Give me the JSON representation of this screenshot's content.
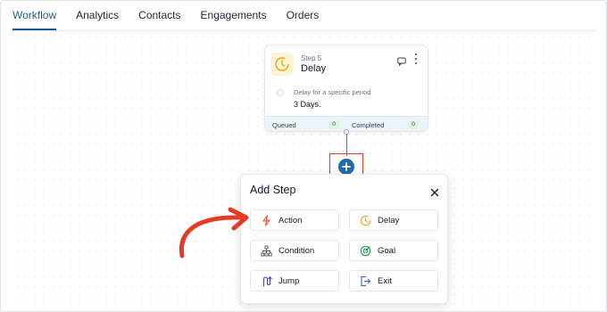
{
  "tabs": [
    {
      "label": "Workflow",
      "active": true
    },
    {
      "label": "Analytics",
      "active": false
    },
    {
      "label": "Contacts",
      "active": false
    },
    {
      "label": "Engagements",
      "active": false
    },
    {
      "label": "Orders",
      "active": false
    }
  ],
  "step": {
    "label": "Step 5",
    "title": "Delay",
    "icon": "clock-icon",
    "description": "Delay for a specific period",
    "value": "3 Days.",
    "footer": {
      "queued_label": "Queued",
      "queued_count": "0",
      "completed_label": "Completed",
      "completed_count": "0"
    }
  },
  "add_step": {
    "title": "Add Step",
    "options": [
      {
        "label": "Action",
        "icon": "lightning-icon"
      },
      {
        "label": "Delay",
        "icon": "clock-icon"
      },
      {
        "label": "Condition",
        "icon": "hierarchy-icon"
      },
      {
        "label": "Goal",
        "icon": "target-icon"
      },
      {
        "label": "Jump",
        "icon": "jump-icon"
      },
      {
        "label": "Exit",
        "icon": "exit-icon"
      }
    ]
  },
  "colors": {
    "accent": "#1e5a91",
    "add_button": "#1f6ca8",
    "highlight": "#e23b26",
    "delay_icon_bg": "#fdf3d7",
    "delay_icon": "#e0a800"
  }
}
